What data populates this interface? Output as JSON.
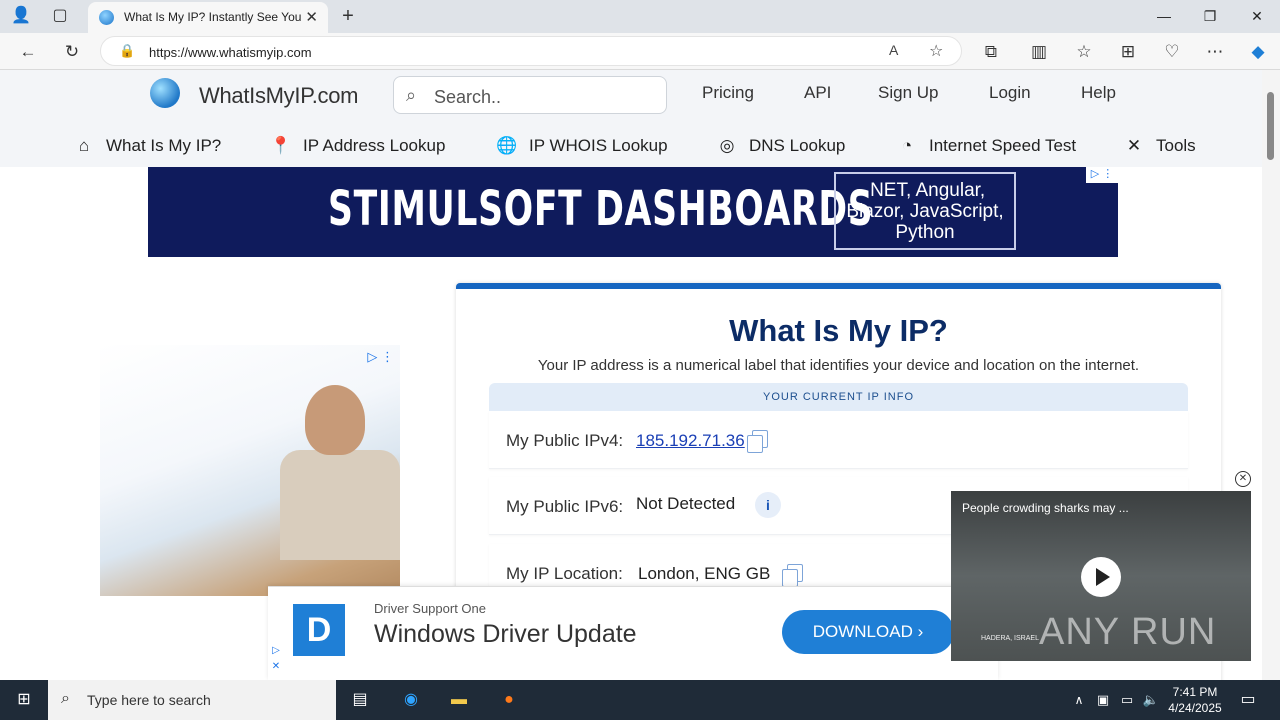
{
  "browser": {
    "tab_title": "What Is My IP? Instantly See Your",
    "url": "https://www.whatismyip.com"
  },
  "site": {
    "logo_text": "WhatIsMyIP.com",
    "search_placeholder": "Search..",
    "top_links": [
      "Pricing",
      "API",
      "Sign Up",
      "Login",
      "Help"
    ],
    "nav": [
      {
        "label": "What Is My IP?",
        "icon": "home-icon"
      },
      {
        "label": "IP Address Lookup",
        "icon": "map-pin-icon"
      },
      {
        "label": "IP WHOIS Lookup",
        "icon": "globe-icon"
      },
      {
        "label": "DNS Lookup",
        "icon": "dns-icon"
      },
      {
        "label": "Internet Speed Test",
        "icon": "speedometer-icon"
      },
      {
        "label": "Tools",
        "icon": "tools-icon"
      }
    ]
  },
  "banner": {
    "headline": "STIMULSOFT DASHBOARDS",
    "box_lines": [
      ".NET, Angular,",
      "Blazor, JavaScript,",
      "Python"
    ]
  },
  "main": {
    "title": "What Is My IP?",
    "subtitle": "Your IP address is a numerical label that identifies your device and location on the internet.",
    "info_header": "YOUR CURRENT IP INFO",
    "rows": [
      {
        "label": "My Public IPv4:",
        "value": "185.192.71.36"
      },
      {
        "label": "My Public IPv6:",
        "value": "Not Detected"
      },
      {
        "label": "My IP Location:",
        "value": "London, ENG GB"
      }
    ]
  },
  "bottom_ad": {
    "brand": "Driver Support One",
    "headline": "Windows Driver Update",
    "cta": "DOWNLOAD"
  },
  "video": {
    "title": "People crowding sharks may ...",
    "watermark": "ANY RUN",
    "caption": "HADERA, ISRAEL"
  },
  "taskbar": {
    "search_placeholder": "Type here to search",
    "time": "7:41 PM",
    "date": "4/24/2025"
  }
}
